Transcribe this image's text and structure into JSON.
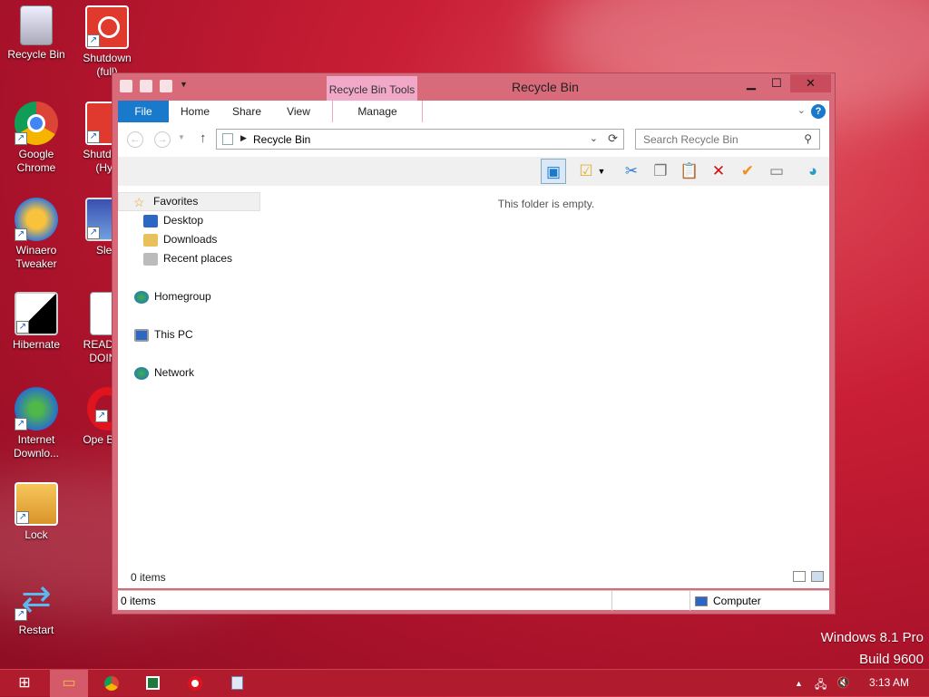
{
  "desktop": {
    "icons": [
      {
        "label": "Recycle Bin",
        "icon": "recycle-bin-icon"
      },
      {
        "label": "Shutdown (full)",
        "icon": "power-icon"
      },
      {
        "label": "Google Chrome",
        "icon": "chrome-icon"
      },
      {
        "label": "Shutdown (Hyb",
        "icon": "power-icon"
      },
      {
        "label": "Winaero Tweaker",
        "icon": "winaero-icon"
      },
      {
        "label": "Slee",
        "icon": "sleep-icon"
      },
      {
        "label": "Hibernate",
        "icon": "hibernate-icon"
      },
      {
        "label": "READ BE DOING",
        "icon": "document-icon"
      },
      {
        "label": "Internet Downlo...",
        "icon": "internet-download-icon"
      },
      {
        "label": "Ope Brow",
        "icon": "opera-icon"
      },
      {
        "label": "Lock",
        "icon": "key-icon"
      },
      {
        "label": "Restart",
        "icon": "restart-icon"
      }
    ]
  },
  "window": {
    "title": "Recycle Bin",
    "context_tab": "Recycle Bin Tools",
    "tabs": {
      "file": "File",
      "home": "Home",
      "share": "Share",
      "view": "View",
      "manage": "Manage"
    },
    "address": "Recycle Bin",
    "search_placeholder": "Search Recycle Bin",
    "nav": {
      "favorites": "Favorites",
      "desktop": "Desktop",
      "downloads": "Downloads",
      "recent": "Recent places",
      "homegroup": "Homegroup",
      "thispc": "This PC",
      "network": "Network"
    },
    "empty_message": "This folder is empty.",
    "item_count": "0 items",
    "status_count": "0 items",
    "status_location": "Computer"
  },
  "watermark": {
    "line1": "Windows 8.1 Pro",
    "line2": "Build 9600"
  },
  "taskbar": {
    "clock": "3:13 AM"
  },
  "colors": {
    "accent": "#1979ca",
    "window_frame": "#d86a7a",
    "context_tab": "#f2a9c8"
  }
}
